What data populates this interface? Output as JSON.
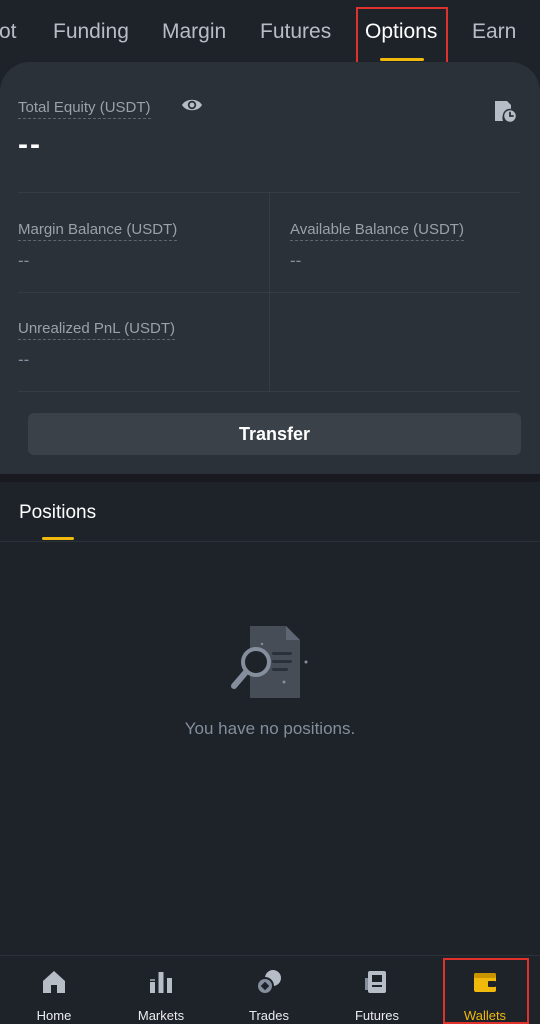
{
  "top_tabs": [
    "ot",
    "Funding",
    "Margin",
    "Futures",
    "Options",
    "Earn"
  ],
  "active_tab": "Options",
  "account": {
    "total_equity_label": "Total Equity (USDT)",
    "total_equity_value": "--",
    "margin_balance_label": "Margin Balance (USDT)",
    "margin_balance_value": "--",
    "available_balance_label": "Available Balance (USDT)",
    "available_balance_value": "--",
    "unrealized_pnl_label": "Unrealized PnL (USDT)",
    "unrealized_pnl_value": "--",
    "transfer_label": "Transfer"
  },
  "positions": {
    "tab_label": "Positions",
    "empty_message": "You have no positions."
  },
  "bottom_nav": [
    {
      "label": "Home",
      "icon": "home-icon"
    },
    {
      "label": "Markets",
      "icon": "markets-icon"
    },
    {
      "label": "Trades",
      "icon": "trades-icon"
    },
    {
      "label": "Futures",
      "icon": "futures-icon"
    },
    {
      "label": "Wallets",
      "icon": "wallet-icon"
    }
  ],
  "colors": {
    "background": "#1e2329",
    "card": "#2b3139",
    "accent": "#f0b90b",
    "highlight": "#e0322c"
  }
}
